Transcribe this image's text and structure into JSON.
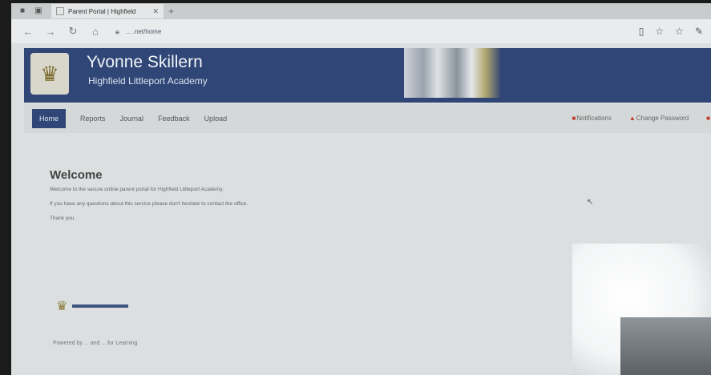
{
  "browser": {
    "tab_title": "Parent Portal | Highfield",
    "url": "... .net/home"
  },
  "header": {
    "name": "Yvonne Skillern",
    "school": "Highfield Littleport Academy"
  },
  "menu": {
    "items": [
      "Home",
      "Reports",
      "Journal",
      "Feedback",
      "Upload"
    ],
    "notifications": "Notifications",
    "change_password": "Change Password"
  },
  "content": {
    "title": "Welcome",
    "line1": "Welcome to the secure online parent portal for Highfield Littleport Academy.",
    "line2": "If you have any questions about this service please don't hesitate to contact the office.",
    "line3": "Thank you."
  },
  "footer": {
    "powered": "Powered by ... and ... for Learning"
  },
  "colors": {
    "brand": "#2f4676",
    "accent": "#c0392b"
  }
}
